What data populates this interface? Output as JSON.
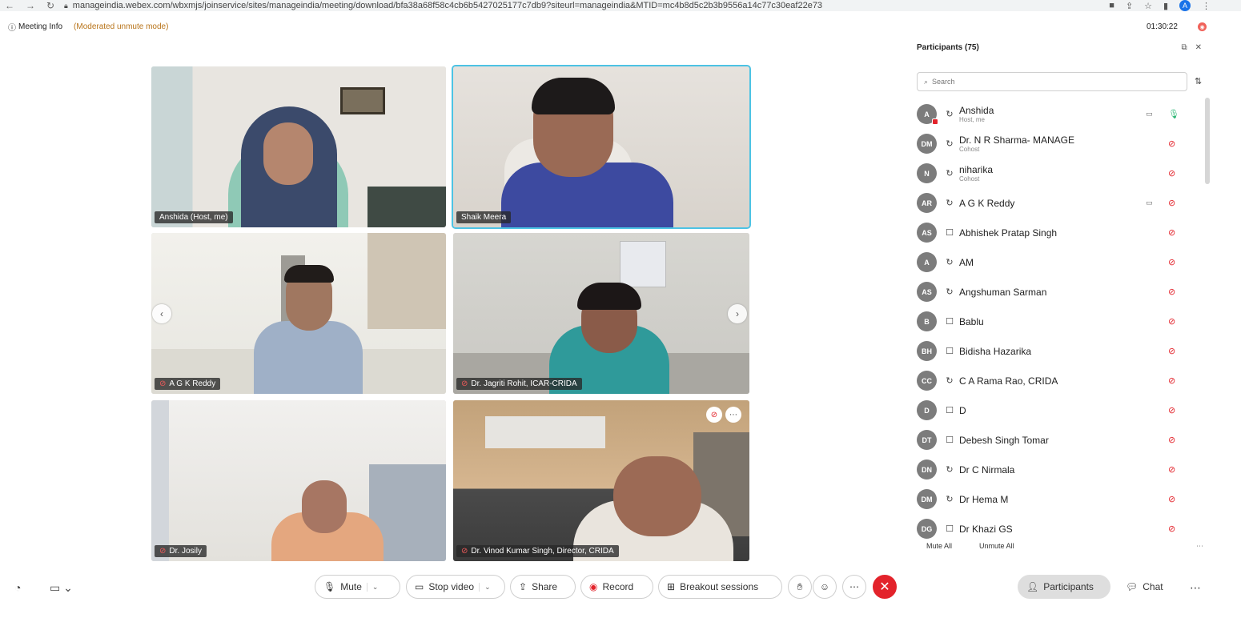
{
  "browser": {
    "url": "manageindia.webex.com/wbxmjs/joinservice/sites/manageindia/meeting/download/bfa38a68f58c4cb6b5427025177c7db9?siteurl=manageindia&MTID=mc4b8d5c2b3b9556a14c77c30eaf22e73",
    "profile_initial": "A"
  },
  "meeting": {
    "info_label": "Meeting Info",
    "mode_label": "(Moderated unmute mode)",
    "timer": "01:30:22"
  },
  "tiles": [
    {
      "name": "Anshida (Host, me)",
      "muted": false
    },
    {
      "name": "Shaik Meera",
      "muted": false
    },
    {
      "name": "A G K Reddy",
      "muted": true
    },
    {
      "name": "Dr. Jagriti Rohit, ICAR-CRIDA",
      "muted": true
    },
    {
      "name": "Dr. Josily",
      "muted": true
    },
    {
      "name": "Dr. Vinod Kumar Singh, Director, CRIDA",
      "muted": true
    }
  ],
  "toolbar": {
    "mute": "Mute",
    "stop_video": "Stop video",
    "share": "Share",
    "record": "Record",
    "breakout": "Breakout sessions",
    "participants": "Participants",
    "chat": "Chat"
  },
  "panel": {
    "title": "Participants (75)",
    "search_placeholder": "Search",
    "mute_all": "Mute All",
    "unmute_all": "Unmute All",
    "participants": [
      {
        "initials": "A",
        "name": "Anshida",
        "role": "Host, me",
        "device": "headset",
        "mic": "on",
        "extra": "video-off-icon"
      },
      {
        "initials": "DM",
        "name": "Dr. N R Sharma- MANAGE",
        "role": "Cohost",
        "device": "headset",
        "mic": "muted"
      },
      {
        "initials": "N",
        "name": "niharika",
        "role": "Cohost",
        "device": "headset",
        "mic": "muted"
      },
      {
        "initials": "AR",
        "name": "A G K Reddy",
        "role": "",
        "device": "headset",
        "mic": "muted",
        "extra": "video-icon"
      },
      {
        "initials": "AS",
        "name": "Abhishek Pratap Singh",
        "role": "",
        "device": "phone",
        "mic": "muted"
      },
      {
        "initials": "A",
        "name": "AM",
        "role": "",
        "device": "headset",
        "mic": "muted"
      },
      {
        "initials": "AS",
        "name": "Angshuman Sarman",
        "role": "",
        "device": "headset",
        "mic": "muted"
      },
      {
        "initials": "B",
        "name": "Bablu",
        "role": "",
        "device": "phone",
        "mic": "muted"
      },
      {
        "initials": "BH",
        "name": "Bidisha Hazarika",
        "role": "",
        "device": "phone",
        "mic": "muted"
      },
      {
        "initials": "CC",
        "name": "C A Rama Rao, CRIDA",
        "role": "",
        "device": "headset",
        "mic": "muted"
      },
      {
        "initials": "D",
        "name": "D",
        "role": "",
        "device": "phone",
        "mic": "muted"
      },
      {
        "initials": "DT",
        "name": "Debesh Singh Tomar",
        "role": "",
        "device": "phone",
        "mic": "muted"
      },
      {
        "initials": "DN",
        "name": "Dr C Nirmala",
        "role": "",
        "device": "headset",
        "mic": "muted"
      },
      {
        "initials": "DM",
        "name": "Dr Hema M",
        "role": "",
        "device": "headset",
        "mic": "muted"
      },
      {
        "initials": "DG",
        "name": "Dr Khazi GS",
        "role": "",
        "device": "phone",
        "mic": "muted"
      }
    ]
  }
}
